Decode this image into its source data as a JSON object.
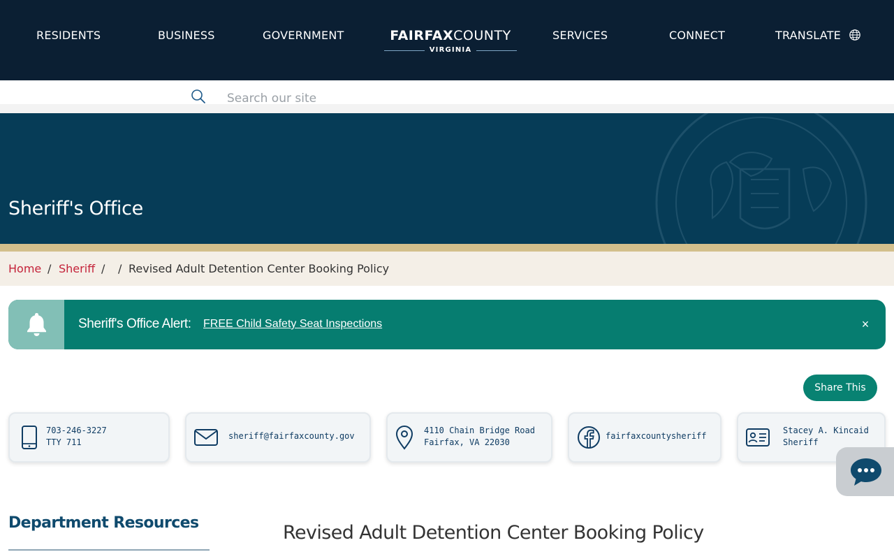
{
  "nav": {
    "residents": "RESIDENTS",
    "business": "BUSINESS",
    "government": "GOVERNMENT",
    "services": "SERVICES",
    "connect": "CONNECT",
    "translate": "TRANSLATE",
    "logo_bold": "FAIRFAX",
    "logo_light": "COUNTY",
    "logo_sub": "VIRGINIA"
  },
  "search": {
    "placeholder": "Search our site"
  },
  "hero": {
    "title": "Sheriff's Office"
  },
  "breadcrumb": {
    "home": "Home",
    "sheriff": "Sheriff",
    "sep": "/",
    "current": "Revised Adult Detention Center Booking Policy"
  },
  "alert": {
    "label": "Sheriff's Office Alert:",
    "link": "FREE Child Safety Seat Inspections",
    "close": "×"
  },
  "share": {
    "label": "Share This"
  },
  "contacts": {
    "phone": {
      "line1": "703-246-3227",
      "line2": "TTY 711"
    },
    "email": {
      "line1": "sheriff@fairfaxcounty.gov"
    },
    "address": {
      "line1": "4110 Chain Bridge Road",
      "line2": "Fairfax, VA 22030"
    },
    "facebook": {
      "line1": "fairfaxcountysheriff"
    },
    "official": {
      "line1": "Stacey A. Kincaid",
      "line2": "Sheriff"
    }
  },
  "sidebar": {
    "title": "Department Resources"
  },
  "main": {
    "heading": "Revised Adult Detention Center Booking Policy"
  },
  "colors": {
    "nav_bg": "#0b1f33",
    "hero_bg": "#063c57",
    "gold": "#d3bf8c",
    "alert_bg": "#067d70",
    "link_red": "#c4233a"
  },
  "icons": [
    "search-icon",
    "globe-icon",
    "bell-icon",
    "close-icon",
    "phone-icon",
    "envelope-icon",
    "map-pin-icon",
    "facebook-icon",
    "id-card-icon",
    "chat-icon"
  ]
}
